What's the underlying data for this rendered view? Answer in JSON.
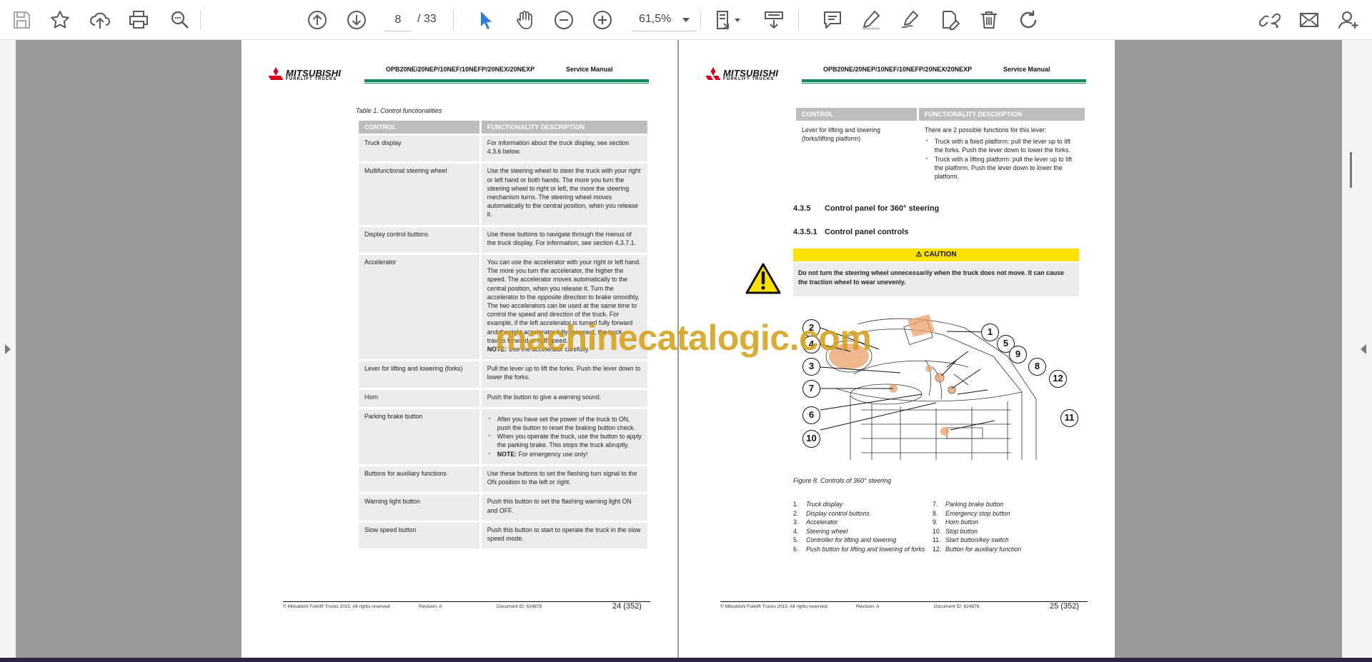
{
  "toolbar": {
    "page_current": "8",
    "page_total": "/ 33",
    "zoom": "61,5%",
    "colors": {
      "icon": "#5a5a5a",
      "select_active": "#2b7de1"
    },
    "icons": [
      "save-icon",
      "bookmark-star-icon",
      "upload-cloud-icon",
      "print-icon",
      "zoom-search-icon",
      "page-up-icon",
      "page-down-icon",
      "select-arrow-icon",
      "hand-icon",
      "zoom-out-icon",
      "zoom-in-icon",
      "page-fit-icon",
      "scroll-mode-icon",
      "comment-icon",
      "highlight-pen-icon",
      "draw-signature-icon",
      "edit-file-icon",
      "delete-icon",
      "rotate-icon",
      "attach-link-icon",
      "email-icon",
      "add-user-icon"
    ]
  },
  "doc": {
    "brand": "MITSUBISHI",
    "brand_sub": "FORKLIFT TRUCKS",
    "model": "OPB20NE/20NEP/10NEF/10NEFP/20NEX/20NEXP",
    "manual": "Service Manual",
    "copyright": "© Mitsubishi Forklift Trucks 2015. All rights reserved.",
    "revision": "Revision: A",
    "document_id": "Document ID: 624878"
  },
  "left_page": {
    "caption": "Table 1. Control functionalities",
    "col_control": "CONTROL",
    "col_function": "FUNCTIONALITY DESCRIPTION",
    "rows": [
      {
        "control": "Truck display",
        "desc": "For information about the truck display, see section 4.3.6 below."
      },
      {
        "control": "Multifunctional steering wheel",
        "desc": "Use the steering wheel to steer the truck with your right or left hand or both hands. The more you turn the steering wheel to right or left, the more the steering mechanism turns. The steering wheel moves automatically to the central position, when you release it."
      },
      {
        "control": "Display control buttons",
        "desc": "Use these buttons to navigate through the menus of the truck display. For information, see section 4.3.7.1."
      },
      {
        "control": "Accelerator",
        "desc": "You can use the accelerator with your right or left hand. The more you turn the accelerator, the higher the speed. The accelerator moves automatically to the central position, when you release it. Turn the accelerator to the opposite direction to brake smoothly. The two accelerators can be used at the same time to control the speed and direction of the truck. For example, if the left accelerator is turned fully forward and the right accelerator fully rearward, the truck travels forward at half speed.",
        "note_label": "NOTE:",
        "note": "Use the accelerator carefully."
      },
      {
        "control": "Lever for lifting and lowering (forks)",
        "desc": "Pull the lever up to lift the forks. Push the lever down to lower the forks."
      },
      {
        "control": "Horn",
        "desc": "Push the button to give a warning sound."
      },
      {
        "control": "Parking brake button",
        "bullets": [
          "After you have set the power of the truck to ON, push the button to reset the braking button check.",
          "When you operate the truck, use the button to apply the parking brake. This stops the truck abruptly."
        ],
        "note_label": "NOTE:",
        "note": "For emergency use only!"
      },
      {
        "control": "Buttons for auxiliary functions",
        "desc": "Use these buttons to set the flashing turn signal to the ON position to the left or right."
      },
      {
        "control": "Warning light button",
        "desc": "Push this button to set the flashing warning light ON and OFF."
      },
      {
        "control": "Slow speed button",
        "desc": "Push this button to start to operate the truck in the slow speed mode."
      }
    ],
    "page_number": "24 (352)"
  },
  "right_page": {
    "col_control": "CONTROL",
    "col_function": "FUNCTIONALITY DESCRIPTION",
    "lever_control": "Lever for lifting and lowering (forks/lifting platform)",
    "lever_intro": "There are 2 possible functions for this lever:",
    "lever_bullets": [
      "Truck with a fixed platform: pull the lever up to lift the forks. Push the lever down to lower the forks.",
      "Truck with a lifting platform: pull the lever up to lift the platform. Push the lever down to lower the platform."
    ],
    "section_num": "4.3.5",
    "section_title": "Control panel for 360° steering",
    "subsection_num": "4.3.5.1",
    "subsection_title": "Control panel controls",
    "caution_label": "CAUTION",
    "caution_text": "Do not turn the steering wheel unnecessarily when the truck does not move. It can cause the traction wheel to wear unevenly.",
    "figure_caption": "Figure 8. Controls of 360° steering",
    "callouts": [
      "1",
      "2",
      "3",
      "4",
      "5",
      "6",
      "7",
      "8",
      "9",
      "10",
      "11",
      "12"
    ],
    "legend_left": [
      {
        "n": "1.",
        "t": "Truck display"
      },
      {
        "n": "2.",
        "t": "Display control buttons"
      },
      {
        "n": "3.",
        "t": "Accelerator"
      },
      {
        "n": "4.",
        "t": "Steering wheel"
      },
      {
        "n": "5.",
        "t": "Controller for lifting and lowering"
      },
      {
        "n": "6.",
        "t": "Push button for lifting and lowering of forks"
      }
    ],
    "legend_right": [
      {
        "n": "7.",
        "t": "Parking brake button"
      },
      {
        "n": "8.",
        "t": "Emergency stop button"
      },
      {
        "n": "9.",
        "t": "Horn button"
      },
      {
        "n": "10.",
        "t": "Stop button"
      },
      {
        "n": "11.",
        "t": "Start button/key switch"
      },
      {
        "n": "12.",
        "t": "Button for auxiliary function"
      }
    ],
    "page_number": "25 (352)"
  },
  "watermark": "machinecatalogic.com"
}
